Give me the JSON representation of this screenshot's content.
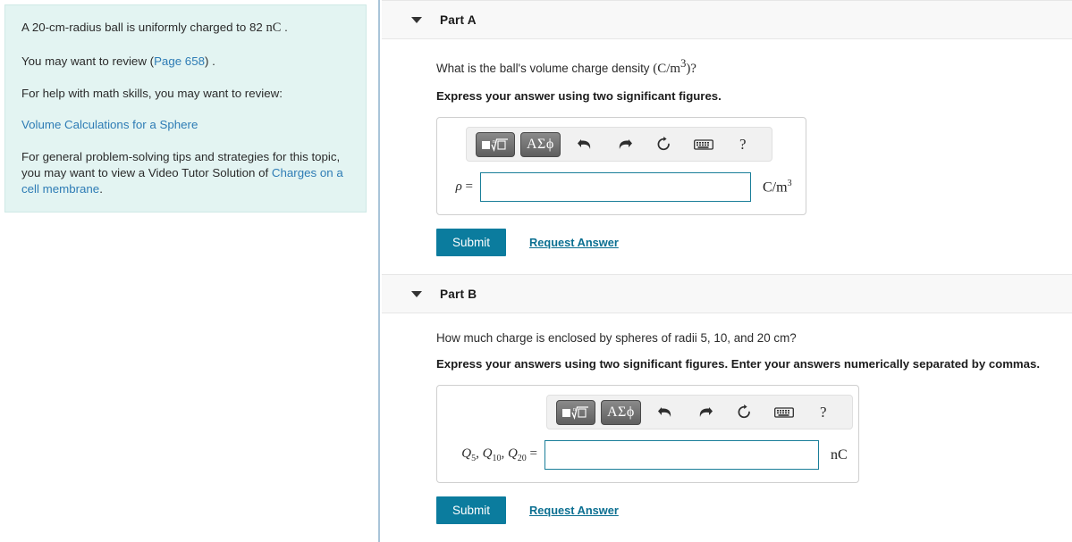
{
  "info_panel": {
    "problem_statement_pre": "A 20-cm-radius ball is uniformly charged to 82 ",
    "problem_statement_unit": "nC",
    "problem_statement_post": " .",
    "review_pre": "You may want to review (",
    "review_link": "Page 658",
    "review_post": ") .",
    "math_skills_intro": "For help with math skills, you may want to review:",
    "math_skills_link": "Volume Calculations for a Sphere",
    "tips_pre": "For general problem-solving tips and strategies for this topic, you may want to view a Video Tutor Solution of ",
    "tips_link": "Charges on a cell membrane",
    "tips_post": "."
  },
  "part_a": {
    "title": "Part A",
    "question_pre": "What is the ball's volume charge density ",
    "question_math": "(C/m",
    "question_math_sup": "3",
    "question_math_post": ")?",
    "instruction": "Express your answer using two significant figures.",
    "toolbar": {
      "template_label": "■",
      "root_label": "√",
      "greek_label": "ΑΣϕ",
      "undo_name": "undo",
      "redo_name": "redo",
      "reset_name": "reset",
      "keyboard_name": "keyboard",
      "help_label": "?"
    },
    "variable_label": "ρ",
    "equals": "=",
    "input_value": "",
    "input_placeholder": "",
    "unit": "C/m",
    "unit_sup": "3",
    "submit_label": "Submit",
    "request_answer_label": "Request Answer"
  },
  "part_b": {
    "title": "Part B",
    "question": "How much charge is enclosed by spheres of radii 5, 10, and 20 cm?",
    "instruction": "Express your answers using two significant figures. Enter your answers numerically separated by commas.",
    "toolbar": {
      "template_label": "■",
      "root_label": "√",
      "greek_label": "ΑΣϕ",
      "undo_name": "undo",
      "redo_name": "redo",
      "reset_name": "reset",
      "keyboard_name": "keyboard",
      "help_label": "?"
    },
    "var_q": "Q",
    "var_sub_1": "5",
    "var_sub_2": "10",
    "var_sub_3": "20",
    "equals": "=",
    "input_value": "",
    "input_placeholder": "",
    "unit": "nC",
    "submit_label": "Submit",
    "request_answer_label": "Request Answer"
  },
  "colors": {
    "info_box_bg": "#e3f4f2",
    "link": "#2e7cb5",
    "submit_bg": "#0b7c9e",
    "input_border": "#1a7e99",
    "divider": "#a9c4d9",
    "header_bg": "#f8f8f8"
  }
}
